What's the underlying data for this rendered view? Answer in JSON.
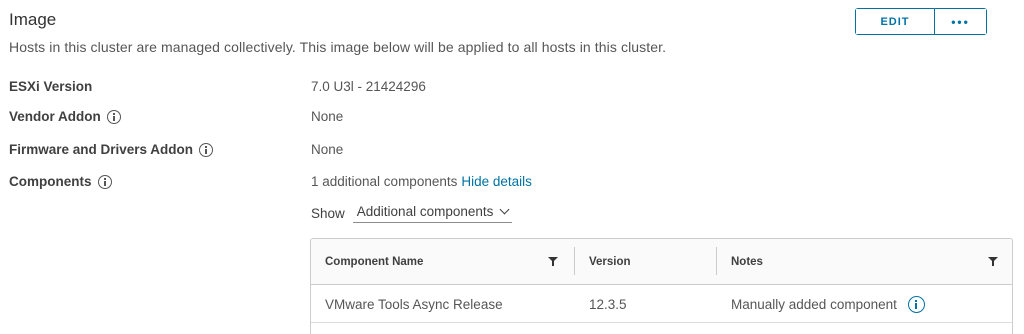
{
  "header": {
    "title": "Image",
    "subtitle": "Hosts in this cluster are managed collectively. This image below will be applied to all hosts in this cluster.",
    "edit_label": "EDIT",
    "more_label": "•••"
  },
  "properties": {
    "esxi_label": "ESXi Version",
    "esxi_value": "7.0 U3l - 21424296",
    "vendor_label": "Vendor Addon",
    "vendor_value": "None",
    "firmware_label": "Firmware and Drivers Addon",
    "firmware_value": "None",
    "components_label": "Components",
    "components_value": "1 additional components",
    "components_link": "Hide details"
  },
  "filter": {
    "show_label": "Show",
    "selected": "Additional components"
  },
  "grid": {
    "columns": [
      "Component Name",
      "Version",
      "Notes"
    ],
    "rows": [
      {
        "name": "VMware Tools Async Release",
        "version": "12.3.5",
        "notes": "Manually added component"
      }
    ]
  },
  "colors": {
    "accent": "#0072a3",
    "text": "#565656"
  }
}
